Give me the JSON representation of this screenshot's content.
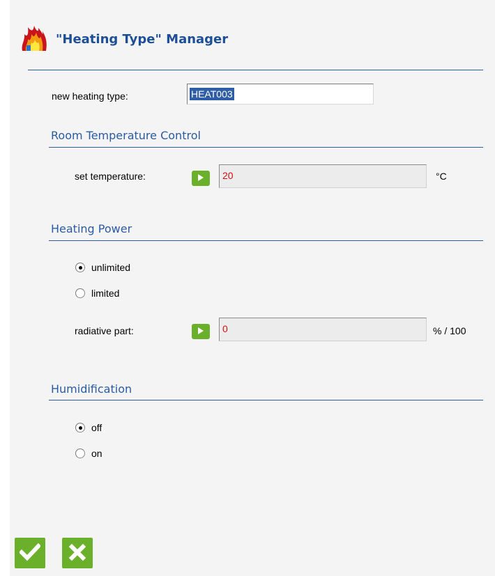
{
  "header": {
    "title": "\"Heating Type\" Manager",
    "icon": "fire-icon"
  },
  "new_type": {
    "label": "new heating type:",
    "value": "HEAT003"
  },
  "room_temperature": {
    "section_title": "Room Temperature Control",
    "set_label": "set temperature:",
    "value": "20",
    "unit": "°C"
  },
  "heating_power": {
    "section_title": "Heating Power",
    "options": [
      "unlimited",
      "limited"
    ],
    "selected": "unlimited",
    "radiative_label": "radiative part:",
    "radiative_value": "0",
    "radiative_unit": "% / 100"
  },
  "humidification": {
    "section_title": "Humidification",
    "options": [
      "off",
      "on"
    ],
    "selected": "off"
  },
  "actions": {
    "ok_icon": "checkmark-icon",
    "cancel_icon": "x-icon"
  },
  "colors": {
    "accent": "#2a5ba3",
    "button_green": "#6bb02a",
    "value_red": "#cc1111"
  }
}
